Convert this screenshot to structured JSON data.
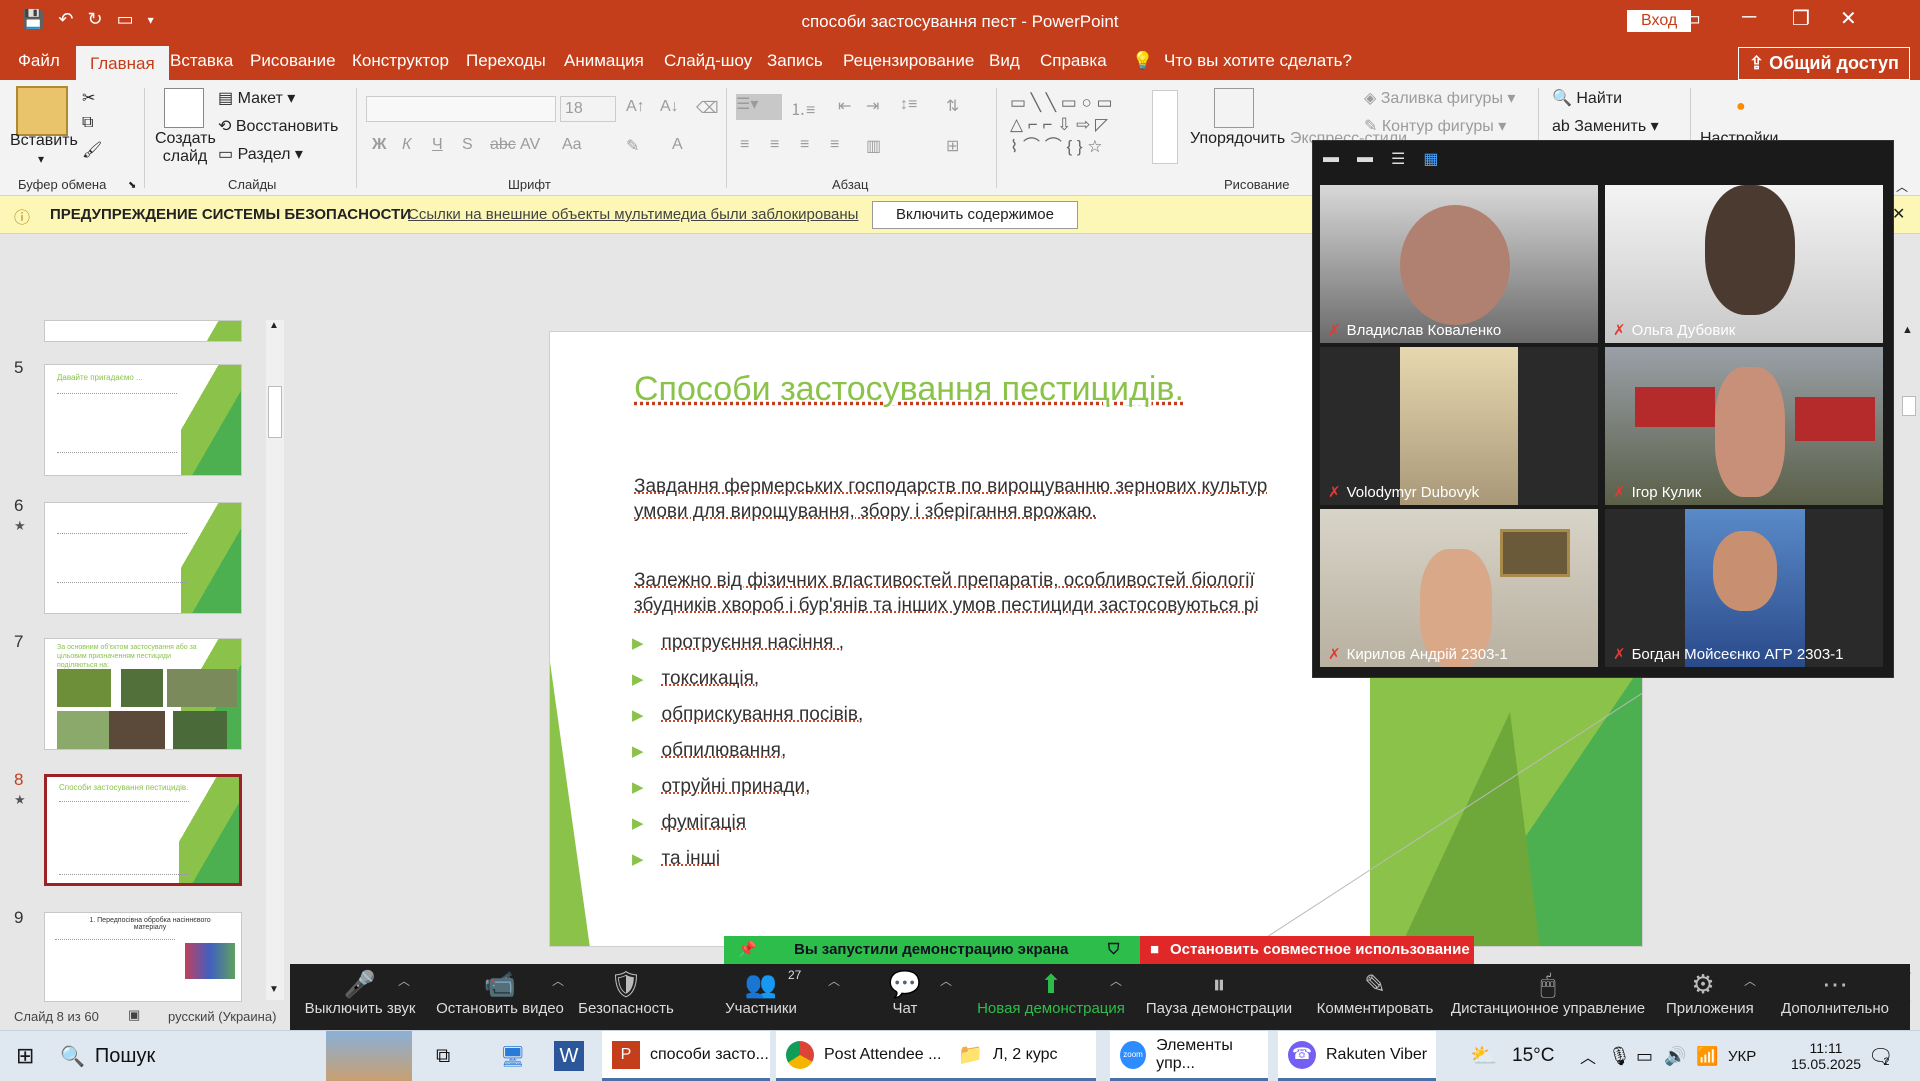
{
  "window": {
    "title": "способи застосування пест  -  PowerPoint",
    "signin": "Вход",
    "share": "Общий доступ",
    "tell_me": "Что вы хотите сделать?"
  },
  "menu": [
    "Файл",
    "Главная",
    "Вставка",
    "Рисование",
    "Конструктор",
    "Переходы",
    "Анимация",
    "Слайд-шоу",
    "Запись",
    "Рецензирование",
    "Вид",
    "Справка"
  ],
  "ribbon": {
    "paste": "Вставить",
    "clipboard": "Буфер обмена",
    "new_slide": "Создать слайд",
    "layout": "Макет",
    "reset": "Восстановить",
    "section": "Раздел",
    "slides": "Слайды",
    "font_size": "18",
    "font": "Шрифт",
    "paragraph": "Абзац",
    "arrange": "Упорядочить",
    "express": "Экспресс-стили",
    "fill": "Заливка фигуры",
    "outline": "Контур фигуры",
    "drawing": "Рисование",
    "find": "Найти",
    "replace": "Заменить",
    "settings": "Настройки"
  },
  "security": {
    "title": "ПРЕДУПРЕЖДЕНИЕ СИСТЕМЫ БЕЗОПАСНОСТИ",
    "message": "Ссылки на внешние объекты мультимедиа были заблокированы",
    "button": "Включить содержимое"
  },
  "thumbs": [
    {
      "num": "5",
      "title": "Давайте пригадаємо ..."
    },
    {
      "num": "6",
      "title": ""
    },
    {
      "num": "7",
      "title": "За основним об'єктом застосування або за цільовим призначенням пестициди поділяються на:"
    },
    {
      "num": "8",
      "title": "Способи застосування пестицидів."
    },
    {
      "num": "9",
      "title": "1. Передпосівна обробка насіннєвого матеріалу"
    }
  ],
  "slide": {
    "title": "Способи застосування пестицидів.",
    "p1_line1": "Завдання фермерських господарств по вирощуванню зернових культур",
    "p1_line2": "умови для вирощування, збору і зберігання врожаю.",
    "p2_line1": "Залежно від фізичних властивостей препаратів, особливостей біології",
    "p2_line2": "збудників хвороб і бур'янів та інших умов пестициди застосовуються рі",
    "bullets": [
      "протруєння насіння ,",
      "токсикація,",
      "обприскування посівів,",
      "обпилювання,",
      "отруйні принади,",
      "фумігація",
      "та інші"
    ]
  },
  "zoom": {
    "participants": [
      {
        "name": "Владислав Коваленко"
      },
      {
        "name": "Ольга Дубовик"
      },
      {
        "name": "Volodymyr Dubovyk"
      },
      {
        "name": "Ігор Кулик"
      },
      {
        "name": "Кирилов Андрій 2303-1"
      },
      {
        "name": "Богдан Мойсеєнко АГР 2303-1"
      }
    ],
    "share_status": "Вы запустили демонстрацию экрана",
    "stop_share": "Остановить совместное использование",
    "participant_count": "27",
    "toolbar": [
      {
        "label": "Выключить звук",
        "icon": "🎤"
      },
      {
        "label": "Остановить видео",
        "icon": "📹"
      },
      {
        "label": "Безопасность",
        "icon": "🛡"
      },
      {
        "label": "Участники",
        "icon": "👥"
      },
      {
        "label": "Чат",
        "icon": "💬"
      },
      {
        "label": "Новая демонстрация",
        "icon": "⬆"
      },
      {
        "label": "Пауза демонстрации",
        "icon": "⏸"
      },
      {
        "label": "Комментировать",
        "icon": "✎"
      },
      {
        "label": "Дистанционное управление",
        "icon": "🖱"
      },
      {
        "label": "Приложения",
        "icon": "⚙"
      },
      {
        "label": "Дополнительно",
        "icon": "⋯"
      }
    ]
  },
  "status": {
    "slide_info": "Слайд 8 из 60",
    "language": "русский (Украина)"
  },
  "taskbar": {
    "search": "Пошук",
    "apps": [
      {
        "label": "способи засто..."
      },
      {
        "label": "Post Attendee ..."
      },
      {
        "label": "Л, 2 курс"
      },
      {
        "label": "Элементы упр..."
      },
      {
        "label": "Rakuten Viber"
      }
    ],
    "weather": "15°C",
    "lang": "УКР",
    "time": "11:11",
    "date": "15.05.2025",
    "notif_count": "2"
  },
  "colors": {
    "accent": "#c43e1c",
    "slide_green": "#8bc34a",
    "zoom_green": "#2dbd4a"
  }
}
